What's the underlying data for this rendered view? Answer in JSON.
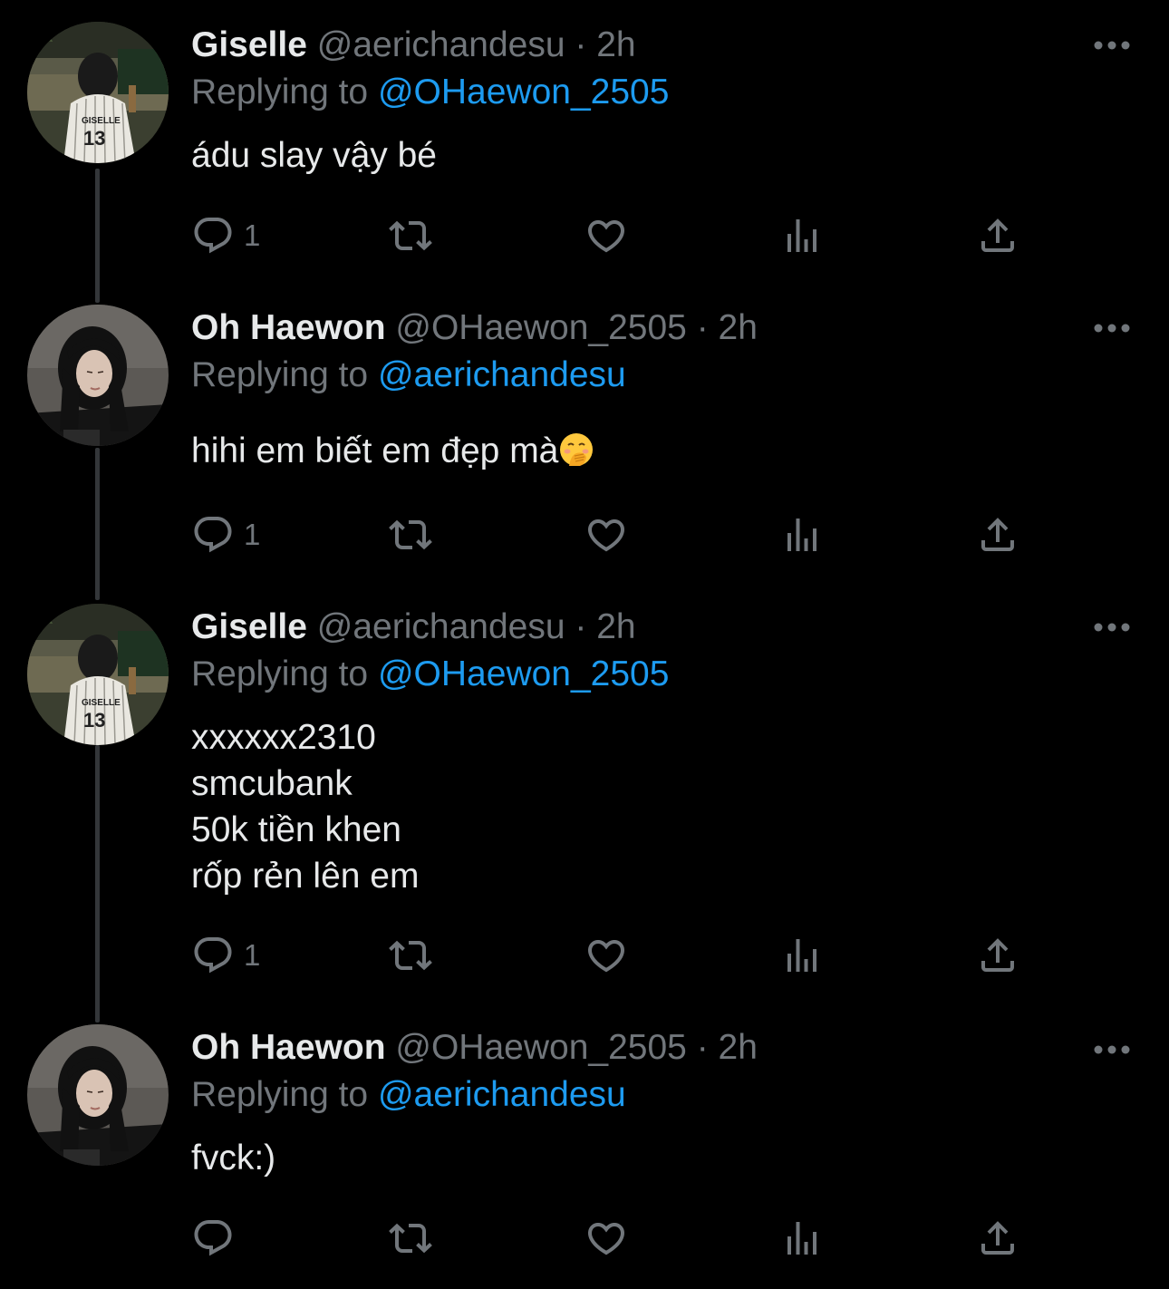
{
  "colors": {
    "background": "#000000",
    "text": "#e7e9ea",
    "secondary": "#71767b",
    "accent": "#1d9bf0",
    "thread_line": "#333639"
  },
  "reply_prefix": "Replying to",
  "tweets": [
    {
      "name": "Giselle",
      "handle": "@aerichandesu",
      "separator": "·",
      "time": "2h",
      "replying_to": "@OHaewon_2505",
      "lines": [
        "ádu slay vậy bé"
      ],
      "reply_count": "1",
      "avatar": "giselle-avatar",
      "icons": [
        "reply-icon",
        "retweet-icon",
        "like-icon",
        "analytics-icon",
        "share-icon",
        "more-icon"
      ]
    },
    {
      "name": "Oh Haewon",
      "handle": "@OHaewon_2505",
      "separator": "·",
      "time": "2h",
      "replying_to": "@aerichandesu",
      "lines": [
        "hihi em biết em đẹp mà"
      ],
      "emoji": "hand-over-mouth-emoji",
      "reply_count": "1",
      "avatar": "haewon-avatar"
    },
    {
      "name": "Giselle",
      "handle": "@aerichandesu",
      "separator": "·",
      "time": "2h",
      "replying_to": "@OHaewon_2505",
      "lines": [
        "xxxxxx2310",
        "smcubank",
        "50k tiền khen",
        "rốp rẻn lên em"
      ],
      "reply_count": "1",
      "avatar": "giselle-avatar"
    },
    {
      "name": "Oh Haewon",
      "handle": "@OHaewon_2505",
      "separator": "·",
      "time": "2h",
      "replying_to": "@aerichandesu",
      "lines": [
        "fvck:)"
      ],
      "reply_count": "",
      "avatar": "haewon-avatar"
    }
  ]
}
